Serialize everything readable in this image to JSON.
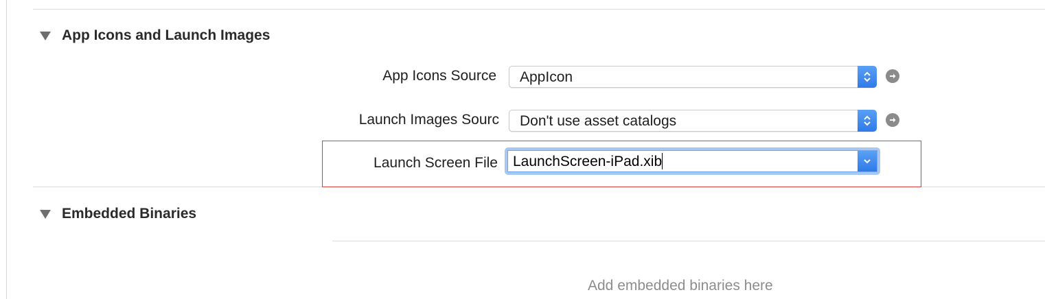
{
  "sections": {
    "app_icons": {
      "title": "App Icons and Launch Images",
      "fields": {
        "app_icons_source": {
          "label": "App Icons Source",
          "value": "AppIcon"
        },
        "launch_images_source": {
          "label": "Launch Images Sourc",
          "value": "Don't use asset catalogs"
        },
        "launch_screen_file": {
          "label": "Launch Screen File",
          "value": "LaunchScreen-iPad.xib"
        }
      }
    },
    "embedded_binaries": {
      "title": "Embedded Binaries",
      "placeholder": "Add embedded binaries here"
    }
  },
  "icons": {
    "disclosure": "disclosure-triangle-icon",
    "stepper": "up-down-chevron-icon",
    "dropdown": "chevron-down-icon",
    "go": "arrow-right-circle-icon"
  },
  "colors": {
    "accent": "#3d86ee",
    "highlight_border": "#d9413a",
    "placeholder_text": "#8c8c8c"
  }
}
